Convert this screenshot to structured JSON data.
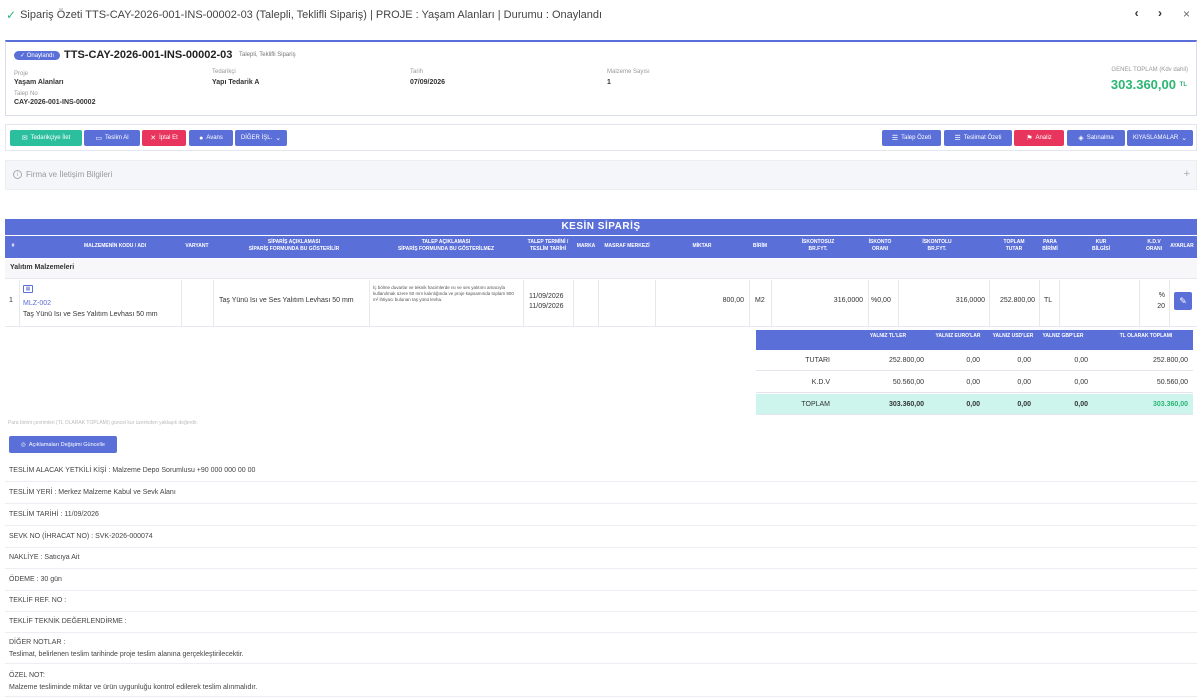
{
  "window": {
    "title": "Sipariş Özeti TTS-CAY-2026-001-INS-00002-03 (Talepli, Teklifli Sipariş) | PROJE : Yaşam Alanları | Durumu : Onaylandı",
    "nav": "‹ ›",
    "close": "×"
  },
  "header": {
    "badge": "✓ Onaylandı",
    "order_no": "TTS-CAY-2026-001-INS-00002-03",
    "order_type": "Talepli, Teklifli Sipariş",
    "project_label": "Proje",
    "project_value": "Yaşam Alanları",
    "supplier_label": "Tedarikçi",
    "supplier_value": "Yapı Tedarik A",
    "date_label": "Tarih",
    "date_value": "07/09/2026",
    "count_label": "Malzeme Sayısı",
    "count_value": "1",
    "request_label": "Talep No",
    "request_value": "CAY-2026-001-INS-00002",
    "total_label": "GENEL TOPLAM (Kdv dahil)",
    "total_value": "303.360,00",
    "total_currency": "TL"
  },
  "toolbar": {
    "left": [
      "Tedarikçiye İlet",
      "Teslim Al",
      "İptal Et",
      "Avans",
      "DİĞER İŞL."
    ],
    "right": [
      "Talep Özeti",
      "Teslimat Özeti",
      "Analiz",
      "Satınalma",
      "KIYASLAMALAR"
    ]
  },
  "firma": {
    "title": "Firma ve İletişim Bilgileri",
    "plus": "+"
  },
  "order_table": {
    "title": "KESİN SİPARİŞ",
    "headers": {
      "no": "#",
      "material": "MALZEMENİN KODU / ADI",
      "variant": "VARYANT",
      "desc_a": "SİPARİŞ AÇIKLAMASI",
      "desc_b": "SİPARİŞ FORMUNDA BU GÖSTERİLİR",
      "req_a": "TALEP AÇIKLAMASI",
      "req_b": "SİPARİŞ FORMUNDA BU GÖSTERİLMEZ",
      "term_a": "TALEP TERMİNİ /",
      "term_b": "TESLİM TARİHİ",
      "brand": "MARKA",
      "cost": "MASRAF MERKEZİ",
      "qty": "MİKTAR",
      "unit": "BİRİM",
      "price_a": "İSKONTOSUZ",
      "price_b": "BR.FYT.",
      "disc_a": "İSKONTO",
      "disc_b": "ORANI",
      "dprice_a": "İSKONTOLU",
      "dprice_b": "BR.FYT.",
      "total_a": "TOPLAM",
      "total_b": "TUTAR",
      "cur_a": "PARA",
      "cur_b": "BİRİMİ",
      "rate_a": "KUR",
      "rate_b": "BİLGİSİ",
      "vat_a": "K.D.V",
      "vat_b": "ORANI",
      "settings": "AYARLAR"
    },
    "group": "Yalıtım Malzemeleri",
    "row": {
      "no": "1",
      "code": "MLZ-002",
      "name": "Taş Yünü Isı ve Ses Yalıtım Levhası 50 mm",
      "order_desc": "Taş Yünü Isı ve Ses Yalıtım Levhası 50 mm",
      "req_desc": "İç bölme duvarlar ve teknik hacimlerde ısı ve ses yalıtımı amacıyla kullanılmak üzere 50 mm kalınlığında ve proje kapsamında toplam 800 m² ihtiyacı bulunan taş yünü levha.",
      "term": "11/09/2026",
      "delivery": "11/09/2026",
      "qty": "800,00",
      "unit": "M2",
      "price": "316,0000",
      "disc": "%0,00",
      "dprice": "316,0000",
      "total": "252.800,00",
      "cur": "TL",
      "vat_pct": "%",
      "vat": "20"
    }
  },
  "summary": {
    "headers": [
      "YALNIZ TL'LER",
      "YALNIZ EURO'LAR",
      "YALNIZ USD'LER",
      "YALNIZ GBP'LER",
      "TL OLARAK TOPLAMI"
    ],
    "rows": [
      {
        "label": "TUTARI",
        "tl": "252.800,00",
        "eur": "0,00",
        "usd": "0,00",
        "gbp": "0,00",
        "sum": "252.800,00"
      },
      {
        "label": "K.D.V",
        "tl": "50.560,00",
        "eur": "0,00",
        "usd": "0,00",
        "gbp": "0,00",
        "sum": "50.560,00"
      },
      {
        "label": "TOPLAM",
        "tl": "303.360,00",
        "eur": "0,00",
        "usd": "0,00",
        "gbp": "0,00",
        "sum": "303.360,00"
      }
    ]
  },
  "note_small": "Para birimi çevrimleri (TL OLARAK TOPLAMI) güncel kur üzerinden yaklaşık değerdir.",
  "update_button": "Açıklamaları Değişimi Güncelle",
  "info": {
    "contact": "TESLİM ALACAK YETKİLİ KİŞİ : Malzeme Depo Sorumlusu +90 000 000 00 00",
    "place": "TESLİM YERİ : Merkez Malzeme Kabul ve Sevk Alanı",
    "date": "TESLİM TARİHİ : 11/09/2026",
    "shipment": "SEVK NO (İHRACAT NO) : SVK-2026-000074",
    "transport": "NAKLİYE : Satıcıya Ait",
    "payment": "ÖDEME : 30 gün",
    "offer_ref": "TEKLİF REF. NO :",
    "tech_eval": "TEKLİF TEKNİK DEĞERLENDİRME :",
    "other_title": "DİĞER NOTLAR :",
    "other_text": "Teslimat, belirlenen teslim tarihinde proje teslim alanına gerçekleştirilecektir.",
    "special_title": "ÖZEL NOT:",
    "special_text": "Malzeme tesliminde miktar ve ürün uygunluğu kontrol edilerek teslim alınmalıdır."
  },
  "colors": {
    "primary": "#5b6fd8",
    "success": "#2bb673",
    "teal": "#2bbf9e",
    "danger": "#e8355d",
    "total_bg": "#cdf5ee"
  }
}
